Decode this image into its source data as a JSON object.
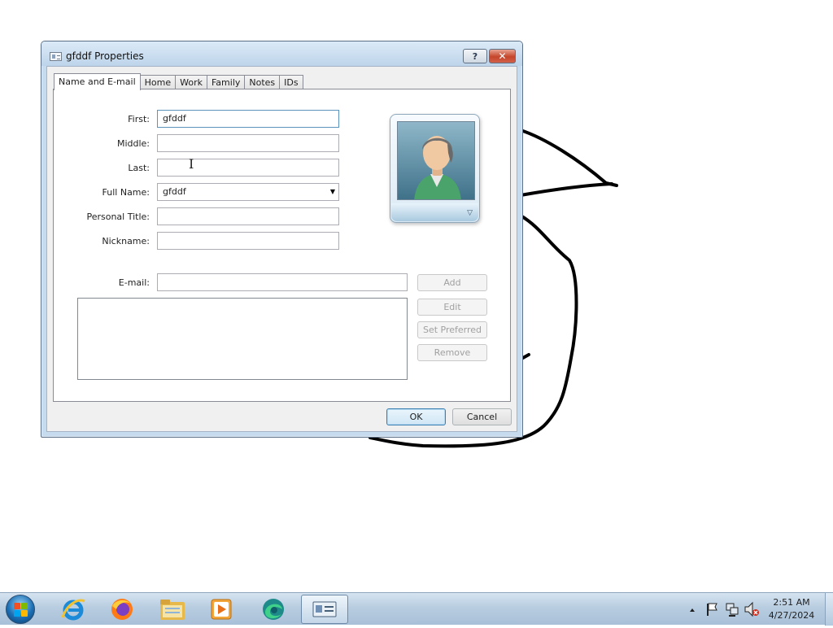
{
  "window": {
    "title": "gfddf Properties",
    "help_glyph": "?",
    "close_glyph": "✕"
  },
  "tabs": [
    {
      "label": "Name and E-mail",
      "active": true
    },
    {
      "label": "Home",
      "active": false
    },
    {
      "label": "Work",
      "active": false
    },
    {
      "label": "Family",
      "active": false
    },
    {
      "label": "Notes",
      "active": false
    },
    {
      "label": "IDs",
      "active": false
    }
  ],
  "form": {
    "first": {
      "label": "First:",
      "value": "gfddf"
    },
    "middle": {
      "label": "Middle:",
      "value": ""
    },
    "last": {
      "label": "Last:",
      "value": ""
    },
    "full_name": {
      "label": "Full Name:",
      "value": "gfddf"
    },
    "personal_title": {
      "label": "Personal Title:",
      "value": ""
    },
    "nickname": {
      "label": "Nickname:",
      "value": ""
    },
    "email": {
      "label": "E-mail:",
      "value": ""
    }
  },
  "email_buttons": {
    "add": "Add",
    "edit": "Edit",
    "set_preferred": "Set Preferred",
    "remove": "Remove"
  },
  "footer": {
    "ok": "OK",
    "cancel": "Cancel"
  },
  "taskbar": {
    "time": "2:51 AM",
    "date": "4/27/2024",
    "apps": [
      "start-orb",
      "internet-explorer",
      "firefox",
      "file-explorer",
      "media-player",
      "edge-app",
      "contacts-window"
    ]
  },
  "colors": {
    "dialog_frame": "#c7dbef",
    "close_button": "#c5452a",
    "taskbar": "#b8cde0",
    "scribble": "#000000"
  }
}
